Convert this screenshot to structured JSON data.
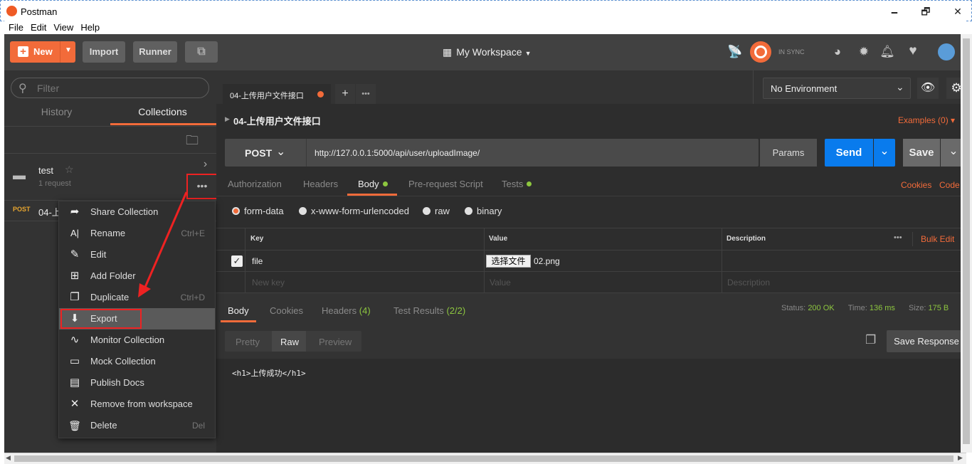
{
  "window": {
    "title": "Postman",
    "minimize": "🗕",
    "maximize": "🗗",
    "close": "✕"
  },
  "menu": [
    "File",
    "Edit",
    "View",
    "Help"
  ],
  "header": {
    "new_label": "New",
    "import_label": "Import",
    "runner_label": "Runner",
    "workspace_label": "My Workspace",
    "sync_label": "IN SYNC"
  },
  "sidebar": {
    "filter_placeholder": "Filter",
    "tab_history": "History",
    "tab_collections": "Collections",
    "collection": {
      "name": "test",
      "count": "1 request"
    },
    "request": {
      "method": "POST",
      "name": "04-上"
    }
  },
  "context_menu": [
    {
      "icon": "share-icon",
      "glyph": "➦",
      "label": "Share Collection",
      "shortcut": ""
    },
    {
      "icon": "rename-icon",
      "glyph": "A|",
      "label": "Rename",
      "shortcut": "Ctrl+E"
    },
    {
      "icon": "edit-icon",
      "glyph": "✎",
      "label": "Edit",
      "shortcut": ""
    },
    {
      "icon": "add-folder-icon",
      "glyph": "⊞",
      "label": "Add Folder",
      "shortcut": ""
    },
    {
      "icon": "duplicate-icon",
      "glyph": "❐",
      "label": "Duplicate",
      "shortcut": "Ctrl+D"
    },
    {
      "icon": "download-icon",
      "glyph": "⬇",
      "label": "Export",
      "shortcut": ""
    },
    {
      "icon": "monitor-icon",
      "glyph": "∿",
      "label": "Monitor Collection",
      "shortcut": ""
    },
    {
      "icon": "mock-icon",
      "glyph": "▭",
      "label": "Mock Collection",
      "shortcut": ""
    },
    {
      "icon": "docs-icon",
      "glyph": "▤",
      "label": "Publish Docs",
      "shortcut": ""
    },
    {
      "icon": "remove-icon",
      "glyph": "✕",
      "label": "Remove from workspace",
      "shortcut": ""
    },
    {
      "icon": "trash-icon",
      "glyph": "🗑",
      "label": "Delete",
      "shortcut": "Del"
    }
  ],
  "environment": {
    "selected": "No Environment"
  },
  "request_tab": {
    "label": "04-上传用户文件接口"
  },
  "request": {
    "title": "04-上传用户文件接口",
    "examples": "Examples (0)",
    "method": "POST",
    "url": "http://127.0.0.1:5000/api/user/uploadImage/",
    "params": "Params",
    "send": "Send",
    "save": "Save"
  },
  "request_tabs": [
    "Authorization",
    "Headers",
    "Body",
    "Pre-request Script",
    "Tests"
  ],
  "request_links": {
    "cookies": "Cookies",
    "code": "Code"
  },
  "body_modes": [
    "form-data",
    "x-www-form-urlencoded",
    "raw",
    "binary"
  ],
  "form_table": {
    "headers": {
      "key": "Key",
      "value": "Value",
      "description": "Description",
      "bulk": "Bulk Edit"
    },
    "rows": [
      {
        "key": "file",
        "choose": "选择文件",
        "file": "02.png"
      }
    ],
    "new_key": "New key",
    "new_value": "Value",
    "new_desc": "Description"
  },
  "response": {
    "tabs": [
      "Body",
      "Cookies",
      "Headers",
      "Test Results"
    ],
    "headers_count": "(4)",
    "tests_count": "(2/2)",
    "status_label": "Status:",
    "status_value": "200 OK",
    "time_label": "Time:",
    "time_value": "136 ms",
    "size_label": "Size:",
    "size_value": "175 B",
    "views": [
      "Pretty",
      "Raw",
      "Preview"
    ],
    "save_response": "Save Response",
    "body": "<h1>上传成功</h1>"
  },
  "colors": {
    "accent": "#f26b3a",
    "send": "#097bed",
    "ok": "#8dc63f"
  }
}
